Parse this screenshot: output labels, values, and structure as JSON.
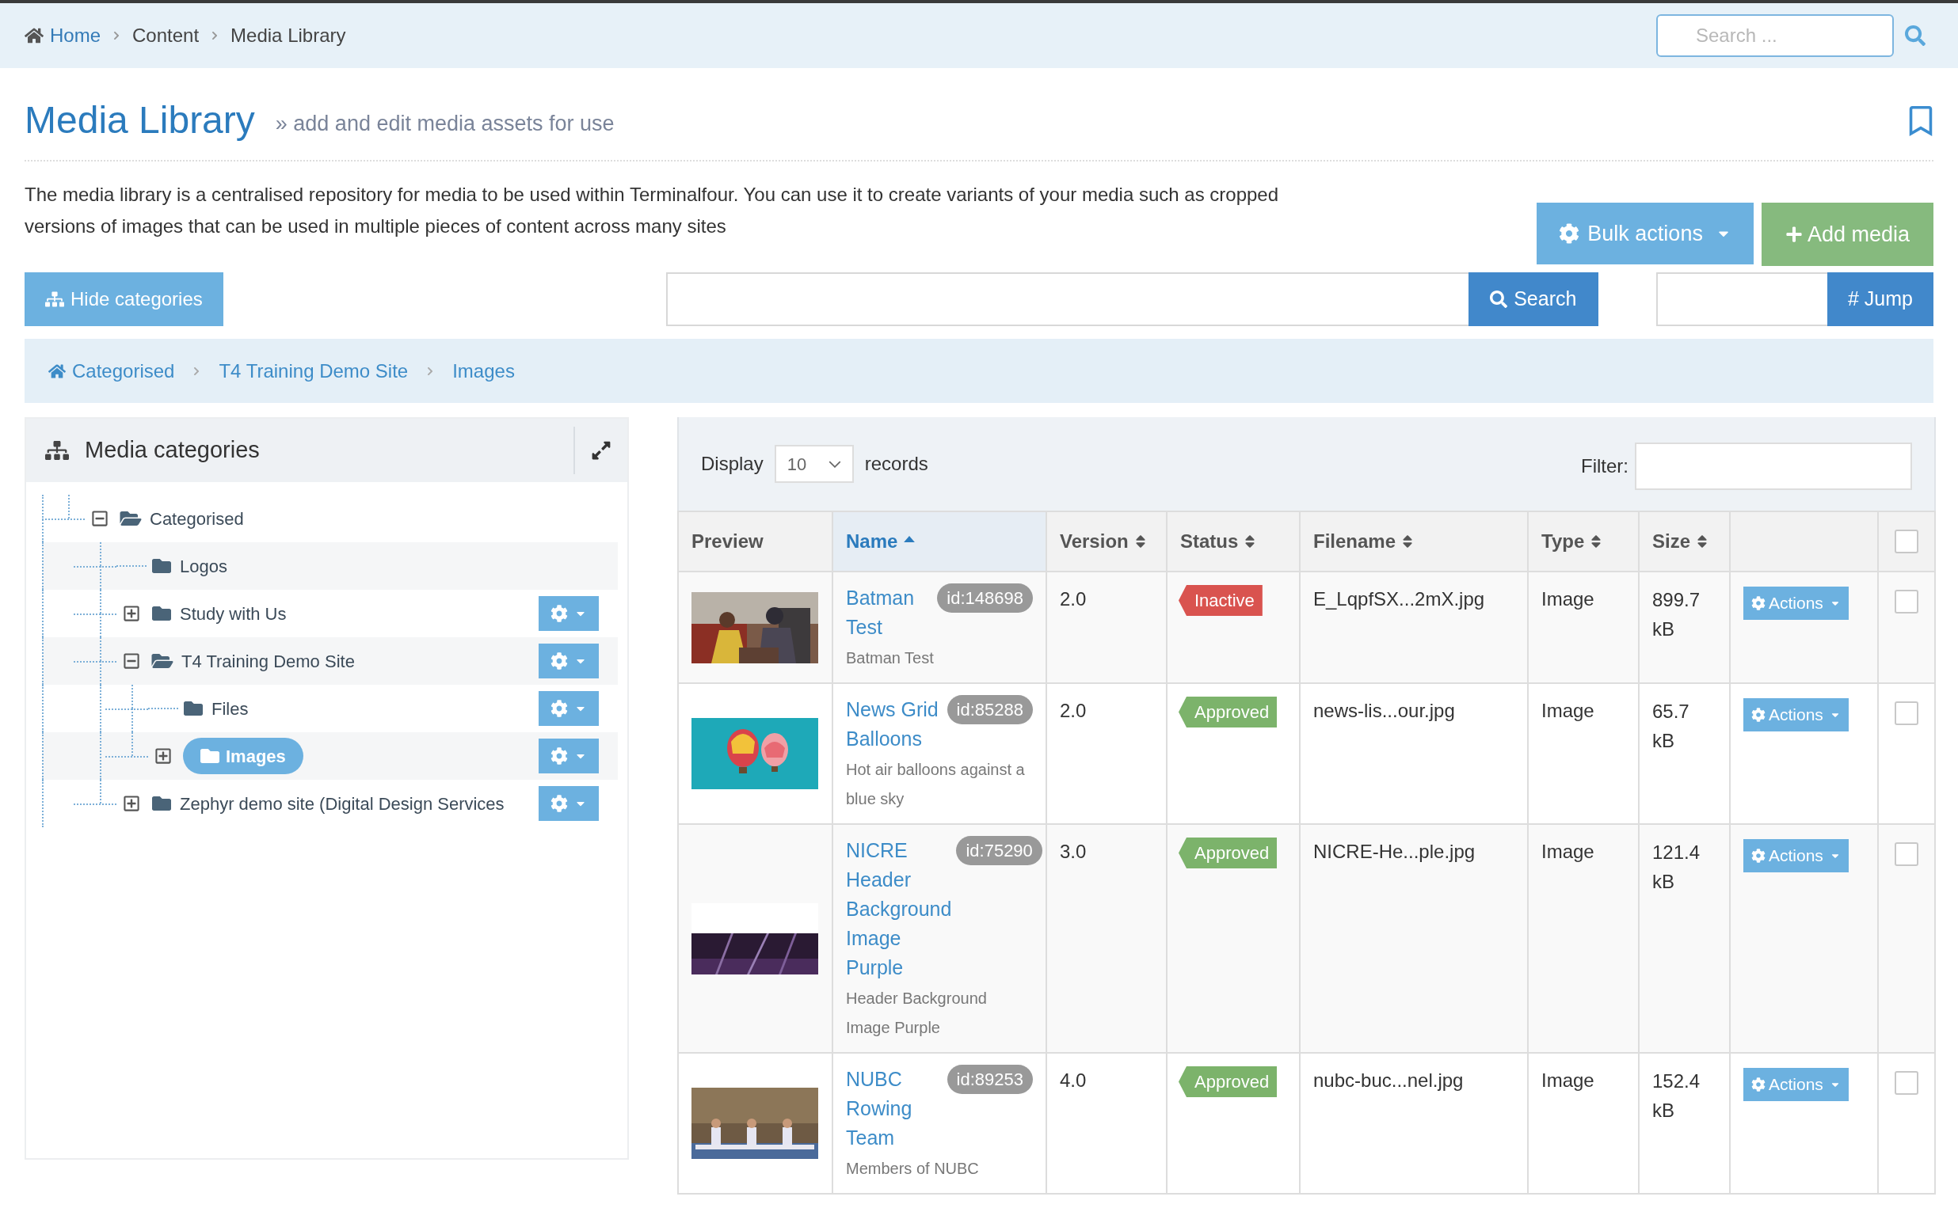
{
  "breadcrumb": [
    {
      "label": "Home",
      "kind": "home"
    },
    {
      "label": "Content",
      "kind": "text"
    },
    {
      "label": "Media Library",
      "kind": "text"
    }
  ],
  "top_search": {
    "placeholder": "Search ..."
  },
  "page": {
    "title": "Media Library",
    "subtitle": "» add and edit media assets for use",
    "description": "The media library is a centralised repository for media to be used within Terminalfour. You can use it to create variants of your media such as cropped versions of images that can be used in multiple pieces of content across many sites"
  },
  "bulk_actions": "Bulk actions",
  "add_media": "Add media",
  "hide_categories": "Hide categories",
  "search": {
    "button": "Search"
  },
  "jump": {
    "button": "# Jump"
  },
  "category_path": [
    {
      "label": "Categorised",
      "kind": "home"
    },
    {
      "label": "T4 Training Demo Site",
      "kind": "link"
    },
    {
      "label": "Images",
      "kind": "link"
    }
  ],
  "categories_panel": {
    "title": "Media categories",
    "tree": [
      {
        "label": "Categorised",
        "expanded": true,
        "selected": false,
        "menu": false,
        "children": [
          {
            "label": "Logos",
            "selected": false,
            "menu": false
          },
          {
            "label": "Study with Us",
            "expanded": false,
            "selected": false,
            "menu": true
          },
          {
            "label": "T4 Training Demo Site",
            "expanded": true,
            "selected": false,
            "menu": true,
            "children": [
              {
                "label": "Files",
                "selected": false,
                "menu": true
              },
              {
                "label": "Images",
                "expanded": false,
                "selected": true,
                "menu": true
              }
            ]
          },
          {
            "label": "Zephyr demo site (Digital Design Services",
            "expanded": false,
            "selected": false,
            "menu": true
          }
        ]
      }
    ]
  },
  "table": {
    "display": {
      "label": "Display",
      "value": "10",
      "suffix": "records"
    },
    "filter": {
      "label": "Filter:"
    },
    "columns": [
      {
        "label": "Preview",
        "kind": "plain"
      },
      {
        "label": "Name",
        "kind": "sorted_asc"
      },
      {
        "label": "Version",
        "kind": "sortable"
      },
      {
        "label": "Status",
        "kind": "sortable"
      },
      {
        "label": "Filename",
        "kind": "sortable"
      },
      {
        "label": "Type",
        "kind": "sortable"
      },
      {
        "label": "Size",
        "kind": "sortable"
      }
    ],
    "select_all": {
      "checked": false
    },
    "rows": [
      {
        "name": "Batman Test",
        "id": "id:148698",
        "description": "Batman Test",
        "version": "2.0",
        "status": {
          "label": "Inactive",
          "kind": "inactive"
        },
        "filename": "E_LqpfSX...2mX.jpg",
        "type": "Image",
        "size": "899.7 kB",
        "actions": "Actions",
        "checked": false
      },
      {
        "name": "News Grid Balloons",
        "id": "id:85288",
        "description": "Hot air balloons against a blue sky",
        "version": "2.0",
        "status": {
          "label": "Approved",
          "kind": "approved"
        },
        "filename": "news-lis...our.jpg",
        "type": "Image",
        "size": "65.7 kB",
        "actions": "Actions",
        "checked": false
      },
      {
        "name": "NICRE Header Background Image Purple",
        "id": "id:75290",
        "description": "Header Background Image Purple",
        "version": "3.0",
        "status": {
          "label": "Approved",
          "kind": "approved"
        },
        "filename": "NICRE-He...ple.jpg",
        "type": "Image",
        "size": "121.4 kB",
        "actions": "Actions",
        "checked": false
      },
      {
        "name": "NUBC Rowing Team",
        "id": "id:89253",
        "description": "Members of NUBC",
        "version": "4.0",
        "status": {
          "label": "Approved",
          "kind": "approved"
        },
        "filename": "nubc-buc...nel.jpg",
        "type": "Image",
        "size": "152.4 kB",
        "actions": "Actions",
        "checked": false
      }
    ]
  }
}
